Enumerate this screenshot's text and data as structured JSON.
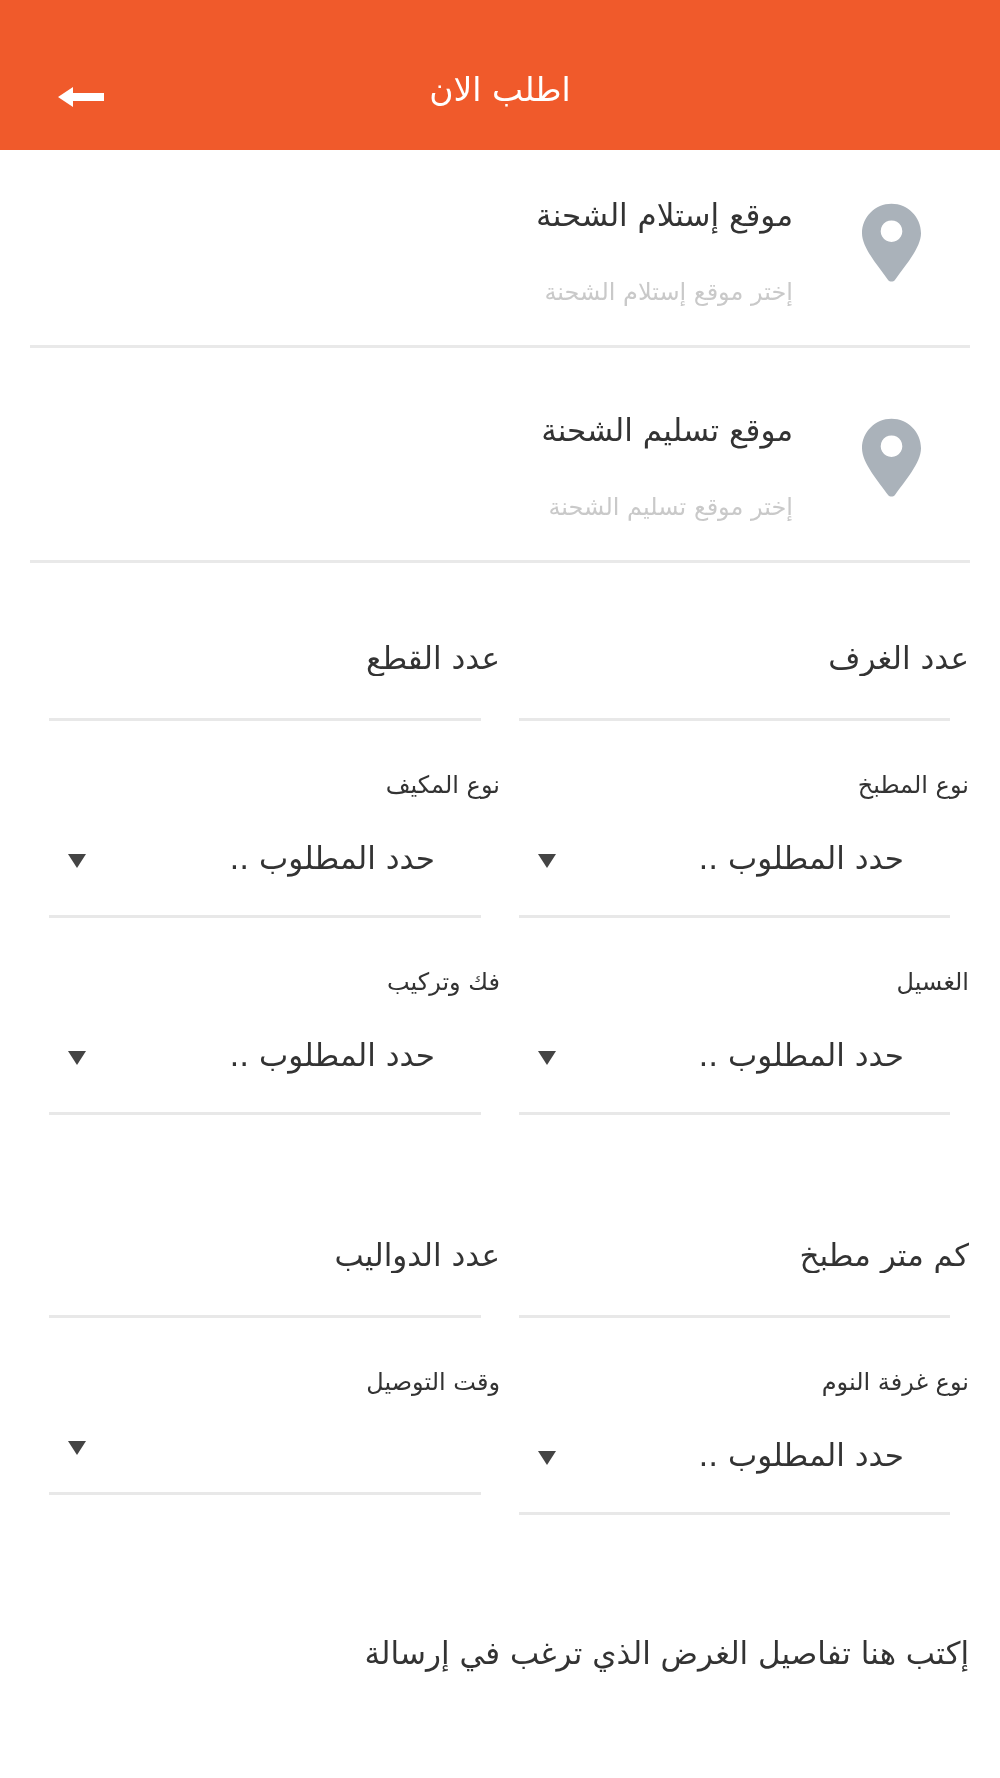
{
  "header": {
    "title": "اطلب الان"
  },
  "locations": [
    {
      "title": "موقع إستلام الشحنة",
      "placeholder": "إختر موقع إستلام الشحنة"
    },
    {
      "title": "موقع تسليم الشحنة",
      "placeholder": "إختر موقع تسليم الشحنة"
    }
  ],
  "field_groups": [
    {
      "fields": [
        {
          "kind": "text",
          "placeholder": "عدد الغرف"
        },
        {
          "kind": "text",
          "placeholder": "عدد القطع"
        },
        {
          "kind": "select",
          "label": "نوع المطبخ",
          "value": "حدد المطلوب .."
        },
        {
          "kind": "select",
          "label": "نوع المكيف",
          "value": "حدد المطلوب .."
        },
        {
          "kind": "select",
          "label": "الغسيل",
          "value": "حدد المطلوب .."
        },
        {
          "kind": "select",
          "label": "فك وتركيب",
          "value": "حدد المطلوب .."
        }
      ]
    },
    {
      "fields": [
        {
          "kind": "text",
          "placeholder": "كم متر مطبخ"
        },
        {
          "kind": "text",
          "placeholder": "عدد الدواليب"
        },
        {
          "kind": "select",
          "label": "نوع غرفة النوم",
          "value": "حدد المطلوب .."
        },
        {
          "kind": "select",
          "label": "وقت التوصيل"
        }
      ]
    }
  ],
  "details": {
    "placeholder": "إكتب هنا تفاصيل الغرض الذي ترغب في إرسالة"
  }
}
